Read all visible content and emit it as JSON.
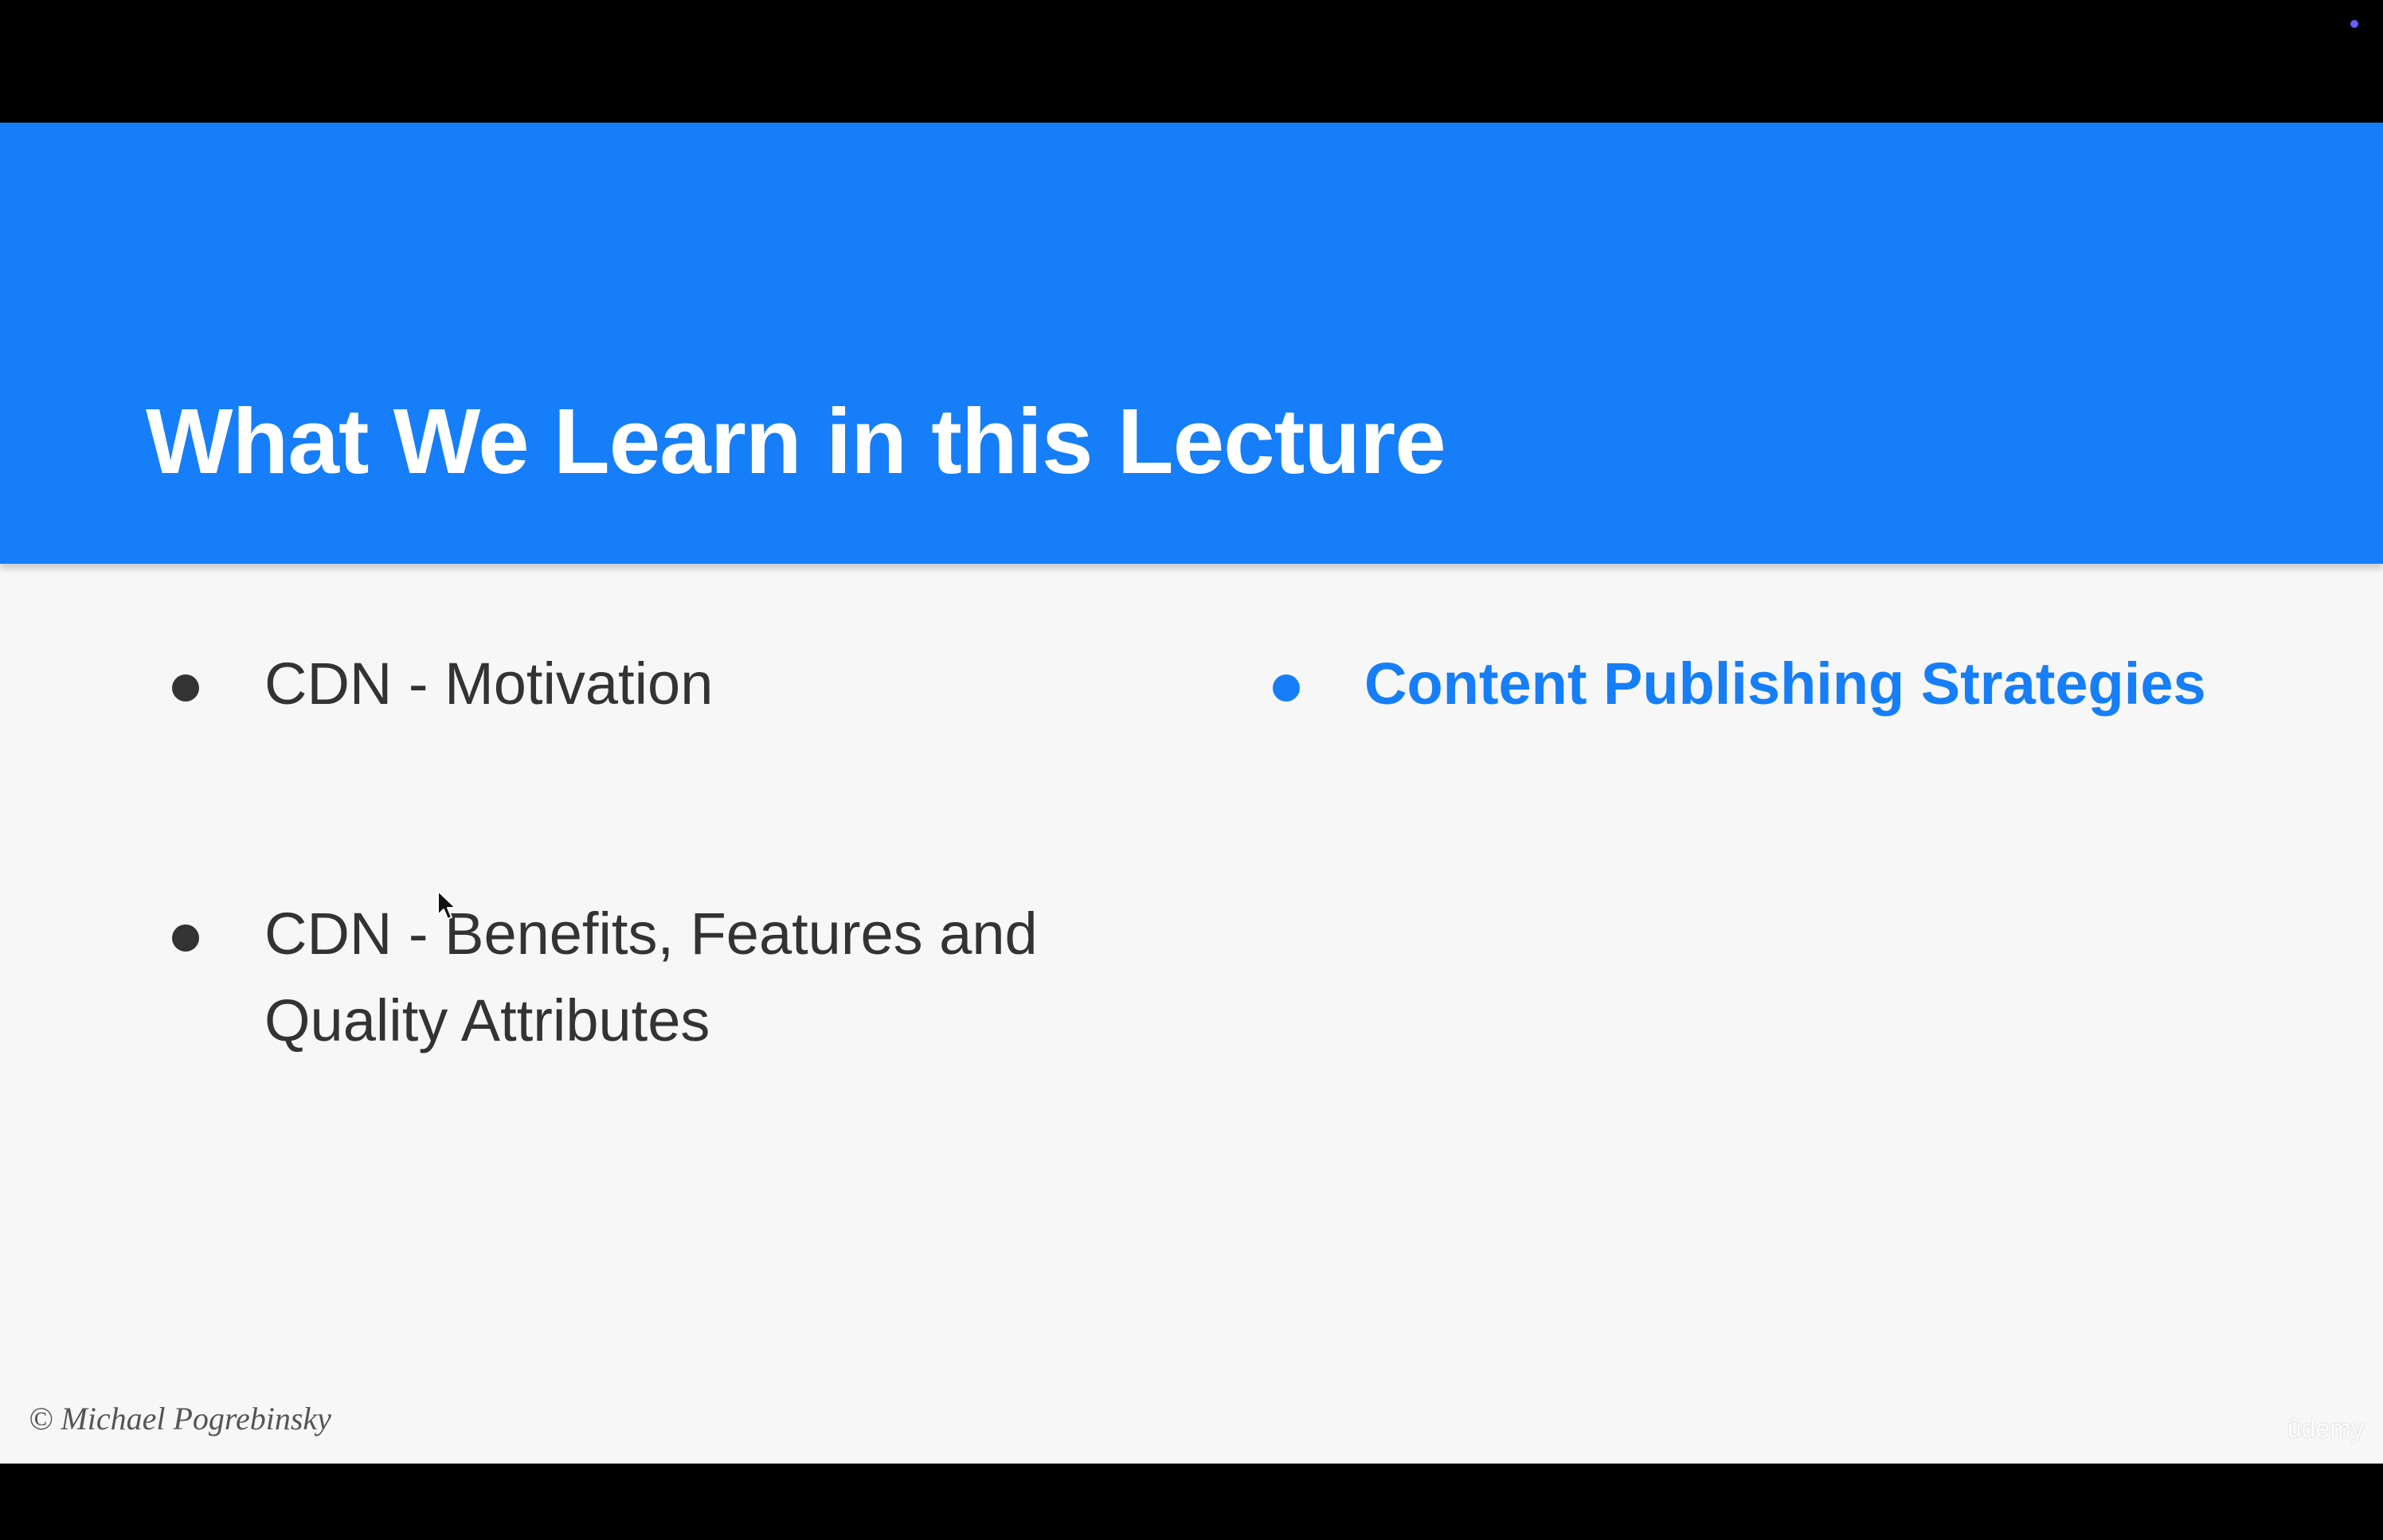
{
  "slide": {
    "title": "What We Learn in this Lecture",
    "bullets": [
      {
        "text": "CDN - Motivation",
        "highlighted": false
      },
      {
        "text": "CDN - Benefits, Features and Quality Attributes",
        "highlighted": false
      },
      {
        "text": "Content Publishing Strategies",
        "highlighted": true
      }
    ],
    "copyright": "© Michael Pogrebinsky",
    "watermark": "ûdemy"
  },
  "colors": {
    "header_blue": "#167ef8",
    "slide_background": "#f7f7f7",
    "bullet_text": "#333333",
    "frame_background": "#000000"
  },
  "icons": {
    "status_indicator": "dot-icon",
    "pointer": "mouse-cursor-icon"
  }
}
